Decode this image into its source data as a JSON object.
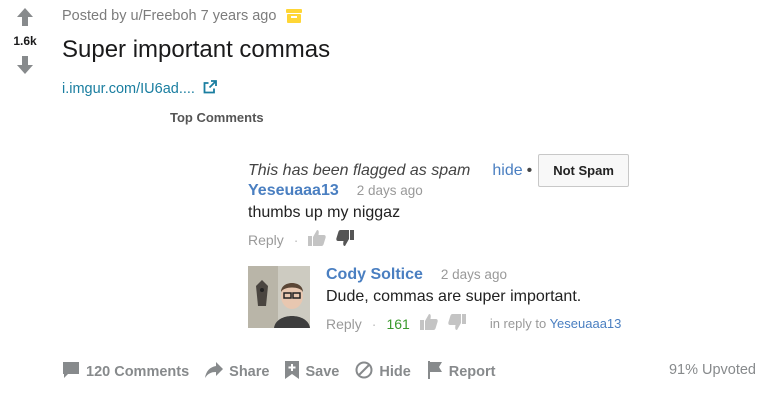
{
  "post": {
    "score": "1.6k",
    "meta": "Posted by u/Freeboh 7 years ago",
    "title": "Super important commas",
    "link_text": "i.imgur.com/IU6ad....",
    "upvoted": "91% Upvoted"
  },
  "embed": {
    "top_comments": "Top Comments",
    "flag_text": "This has been flagged as spam",
    "hide": "hide",
    "dot": "•",
    "not_spam": "Not Spam",
    "comment1": {
      "author": "Yeseuaaa13",
      "time": "2 days ago",
      "text": "thumbs up my niggaz",
      "reply": "Reply",
      "sep": "·"
    },
    "comment2": {
      "author": "Cody Soltice",
      "time": "2 days ago",
      "text": "Dude, commas are super important.",
      "reply": "Reply",
      "sep": "·",
      "likes": "161",
      "in_reply_prefix": "in reply to ",
      "in_reply_to": "Yeseuaaa13"
    }
  },
  "actions": {
    "comments": "120 Comments",
    "share": "Share",
    "save": "Save",
    "hide": "Hide",
    "report": "Report"
  },
  "colors": {
    "link": "#1a7ea0",
    "comment_author": "#4a7fc1",
    "likes": "#3a9a2c",
    "muted": "#878a8c",
    "archive_badge": "#ffd635"
  },
  "icons": [
    "upvote-icon",
    "downvote-icon",
    "archive-icon",
    "external-link-icon",
    "thumbs-up-icon",
    "thumbs-down-icon",
    "comment-icon",
    "share-icon",
    "save-icon",
    "hide-icon",
    "report-icon"
  ]
}
